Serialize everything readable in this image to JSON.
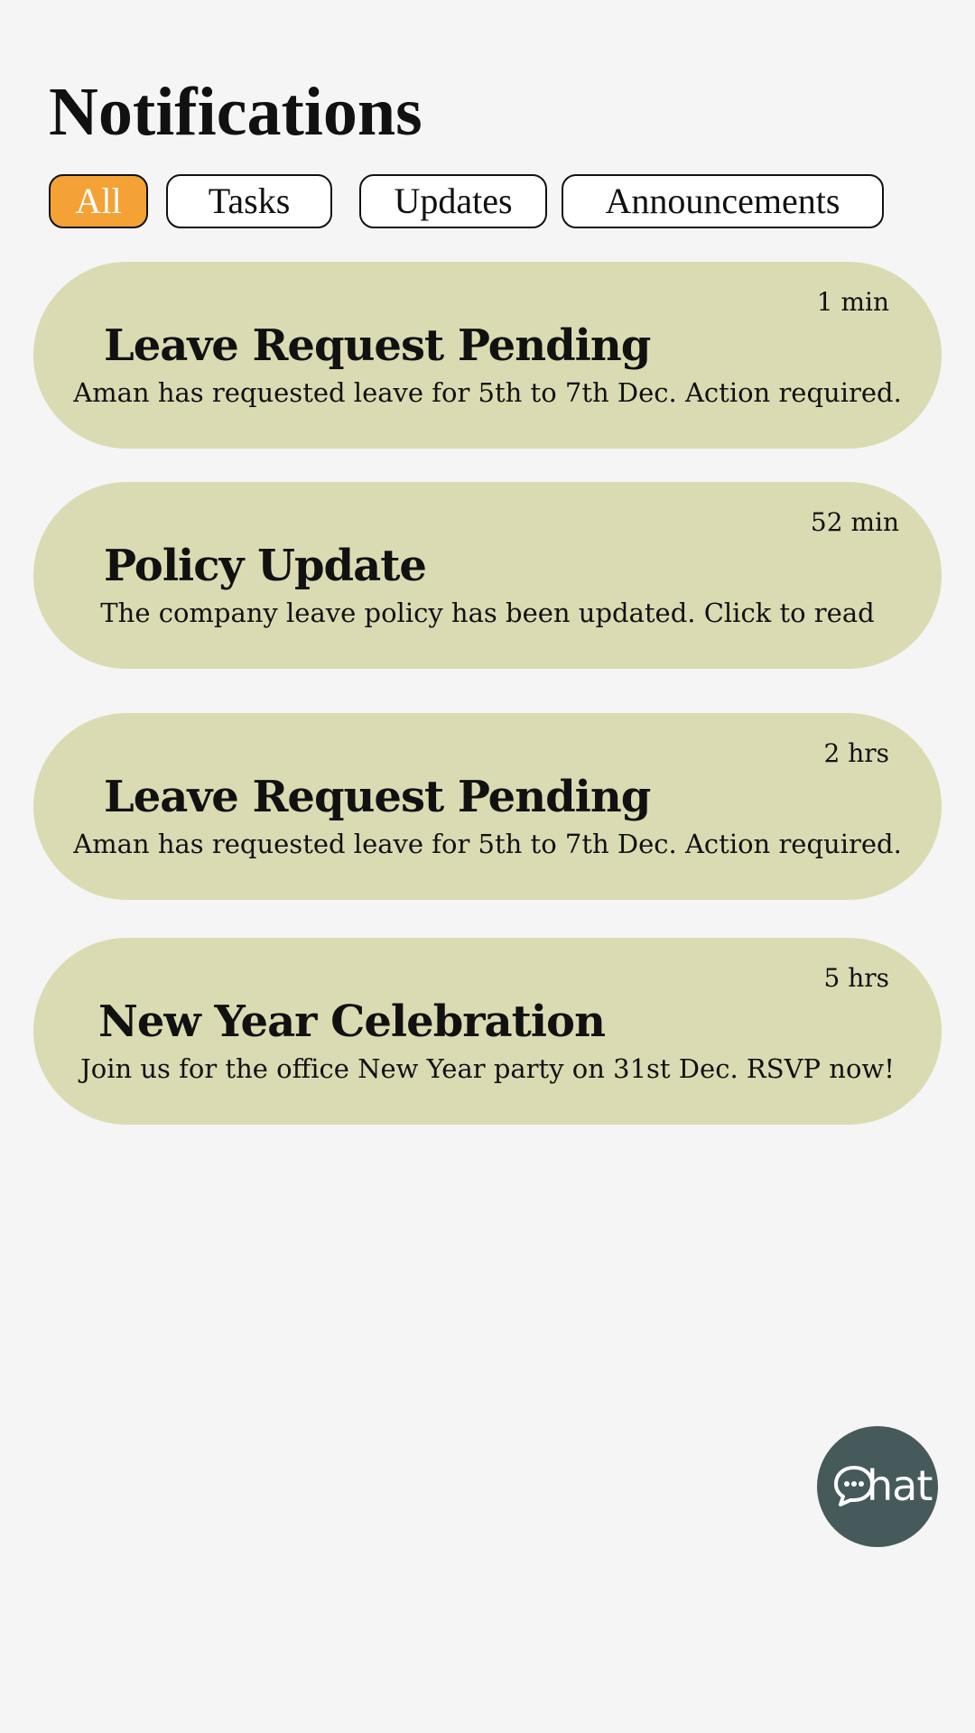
{
  "header": {
    "title": "Notifications"
  },
  "filters": [
    {
      "label": "All",
      "selected": true
    },
    {
      "label": "Tasks",
      "selected": false
    },
    {
      "label": "Updates",
      "selected": false
    },
    {
      "label": "Announcements",
      "selected": false
    }
  ],
  "notifications": [
    {
      "time": "1 min",
      "title": "Leave Request Pending",
      "body": "Aman has requested leave for 5th to 7th Dec. Action required."
    },
    {
      "time": "52 min",
      "title": "Policy Update",
      "body": "The company leave policy has been updated. Click to read"
    },
    {
      "time": "2 hrs",
      "title": "Leave Request Pending",
      "body": "Aman has requested leave for 5th to 7th Dec. Action required."
    },
    {
      "time": "5 hrs",
      "title": "New Year Celebration",
      "body": "Join us for the office New Year party on 31st Dec. RSVP now!"
    }
  ],
  "chat_button": {
    "icon": "chat-bubble-icon",
    "label": "hat"
  },
  "colors": {
    "background": "#f5f5f5",
    "active_filter": "#f4a236",
    "card": "#dbdbb3",
    "chat_button": "#465a5c"
  }
}
